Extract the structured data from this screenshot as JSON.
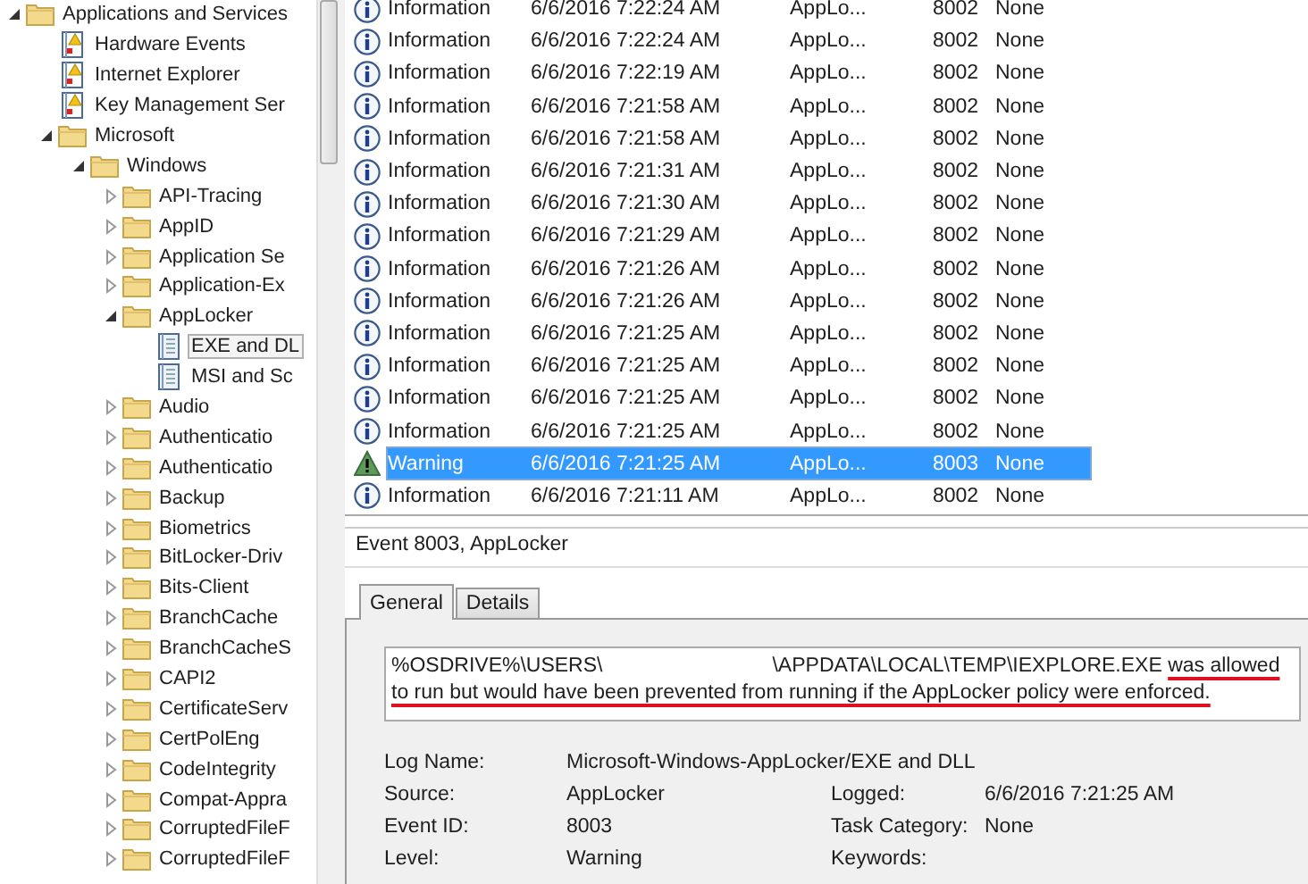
{
  "tree": [
    {
      "label": "Applications and Services",
      "kind": "folder",
      "expanded": true,
      "selected": false,
      "children": [
        {
          "label": "Hardware Events",
          "kind": "alert-log",
          "selected": false
        },
        {
          "label": "Internet Explorer",
          "kind": "alert-log",
          "selected": false
        },
        {
          "label": "Key Management Ser",
          "kind": "alert-log",
          "selected": false
        },
        {
          "label": "Microsoft",
          "kind": "folder",
          "expanded": true,
          "selected": false,
          "children": [
            {
              "label": "Windows",
              "kind": "folder",
              "expanded": true,
              "selected": false,
              "children": [
                {
                  "label": "API-Tracing",
                  "kind": "folder",
                  "expanded": false,
                  "selected": false
                },
                {
                  "label": "AppID",
                  "kind": "folder",
                  "expanded": false,
                  "selected": false
                },
                {
                  "label": "Application Se",
                  "kind": "folder",
                  "expanded": false,
                  "selected": false
                },
                {
                  "label": "Application-Ex",
                  "kind": "folder",
                  "expanded": false,
                  "selected": false
                },
                {
                  "label": "AppLocker",
                  "kind": "folder",
                  "expanded": true,
                  "selected": false,
                  "children": [
                    {
                      "label": "EXE and DL",
                      "kind": "log",
                      "selected": true
                    },
                    {
                      "label": "MSI and Sc",
                      "kind": "log",
                      "selected": false
                    }
                  ]
                },
                {
                  "label": "Audio",
                  "kind": "folder",
                  "expanded": false,
                  "selected": false
                },
                {
                  "label": "Authenticatio",
                  "kind": "folder",
                  "expanded": false,
                  "selected": false
                },
                {
                  "label": "Authenticatio",
                  "kind": "folder",
                  "expanded": false,
                  "selected": false
                },
                {
                  "label": "Backup",
                  "kind": "folder",
                  "expanded": false,
                  "selected": false
                },
                {
                  "label": "Biometrics",
                  "kind": "folder",
                  "expanded": false,
                  "selected": false
                },
                {
                  "label": "BitLocker-Driv",
                  "kind": "folder",
                  "expanded": false,
                  "selected": false
                },
                {
                  "label": "Bits-Client",
                  "kind": "folder",
                  "expanded": false,
                  "selected": false
                },
                {
                  "label": "BranchCache",
                  "kind": "folder",
                  "expanded": false,
                  "selected": false
                },
                {
                  "label": "BranchCacheS",
                  "kind": "folder",
                  "expanded": false,
                  "selected": false
                },
                {
                  "label": "CAPI2",
                  "kind": "folder",
                  "expanded": false,
                  "selected": false
                },
                {
                  "label": "CertificateServ",
                  "kind": "folder",
                  "expanded": false,
                  "selected": false
                },
                {
                  "label": "CertPolEng",
                  "kind": "folder",
                  "expanded": false,
                  "selected": false
                },
                {
                  "label": "CodeIntegrity",
                  "kind": "folder",
                  "expanded": false,
                  "selected": false
                },
                {
                  "label": "Compat-Appra",
                  "kind": "folder",
                  "expanded": false,
                  "selected": false
                },
                {
                  "label": "CorruptedFileF",
                  "kind": "folder",
                  "expanded": false,
                  "selected": false
                },
                {
                  "label": "CorruptedFileF",
                  "kind": "folder",
                  "expanded": false,
                  "selected": false
                }
              ]
            }
          ]
        }
      ]
    }
  ],
  "events": [
    {
      "kind": "information",
      "label": "Information",
      "date": "6/6/2016 7:22:24 AM",
      "source": "AppLo...",
      "event_id": "8002",
      "task": "None",
      "selected": false
    },
    {
      "kind": "information",
      "label": "Information",
      "date": "6/6/2016 7:22:24 AM",
      "source": "AppLo...",
      "event_id": "8002",
      "task": "None",
      "selected": false
    },
    {
      "kind": "information",
      "label": "Information",
      "date": "6/6/2016 7:22:19 AM",
      "source": "AppLo...",
      "event_id": "8002",
      "task": "None",
      "selected": false
    },
    {
      "kind": "information",
      "label": "Information",
      "date": "6/6/2016 7:21:58 AM",
      "source": "AppLo...",
      "event_id": "8002",
      "task": "None",
      "selected": false
    },
    {
      "kind": "information",
      "label": "Information",
      "date": "6/6/2016 7:21:58 AM",
      "source": "AppLo...",
      "event_id": "8002",
      "task": "None",
      "selected": false
    },
    {
      "kind": "information",
      "label": "Information",
      "date": "6/6/2016 7:21:31 AM",
      "source": "AppLo...",
      "event_id": "8002",
      "task": "None",
      "selected": false
    },
    {
      "kind": "information",
      "label": "Information",
      "date": "6/6/2016 7:21:30 AM",
      "source": "AppLo...",
      "event_id": "8002",
      "task": "None",
      "selected": false
    },
    {
      "kind": "information",
      "label": "Information",
      "date": "6/6/2016 7:21:29 AM",
      "source": "AppLo...",
      "event_id": "8002",
      "task": "None",
      "selected": false
    },
    {
      "kind": "information",
      "label": "Information",
      "date": "6/6/2016 7:21:26 AM",
      "source": "AppLo...",
      "event_id": "8002",
      "task": "None",
      "selected": false
    },
    {
      "kind": "information",
      "label": "Information",
      "date": "6/6/2016 7:21:26 AM",
      "source": "AppLo...",
      "event_id": "8002",
      "task": "None",
      "selected": false
    },
    {
      "kind": "information",
      "label": "Information",
      "date": "6/6/2016 7:21:25 AM",
      "source": "AppLo...",
      "event_id": "8002",
      "task": "None",
      "selected": false
    },
    {
      "kind": "information",
      "label": "Information",
      "date": "6/6/2016 7:21:25 AM",
      "source": "AppLo...",
      "event_id": "8002",
      "task": "None",
      "selected": false
    },
    {
      "kind": "information",
      "label": "Information",
      "date": "6/6/2016 7:21:25 AM",
      "source": "AppLo...",
      "event_id": "8002",
      "task": "None",
      "selected": false
    },
    {
      "kind": "information",
      "label": "Information",
      "date": "6/6/2016 7:21:25 AM",
      "source": "AppLo...",
      "event_id": "8002",
      "task": "None",
      "selected": false
    },
    {
      "kind": "warning",
      "label": "Warning",
      "date": "6/6/2016 7:21:25 AM",
      "source": "AppLo...",
      "event_id": "8003",
      "task": "None",
      "selected": true
    },
    {
      "kind": "information",
      "label": "Information",
      "date": "6/6/2016 7:21:11 AM",
      "source": "AppLo...",
      "event_id": "8002",
      "task": "None",
      "selected": false
    }
  ],
  "detail": {
    "title": "Event 8003, AppLocker",
    "tabs": [
      {
        "label": "General",
        "selected": true
      },
      {
        "label": "Details",
        "selected": false
      }
    ],
    "message": {
      "path_start": "%OSDRIVE%\\USERS\\",
      "path_end": "\\APPDATA\\LOCAL\\TEMP\\IEXPLORE.EXE",
      "sentence": "was allowed to run but would have been prevented from running if the AppLocker policy were enforced."
    },
    "fields": [
      [
        {
          "label": "Log Name:",
          "value": "Microsoft-Windows-AppLocker/EXE and DLL"
        }
      ],
      [
        {
          "label": "Source:",
          "value": "AppLocker"
        },
        {
          "label": "Logged:",
          "value": "6/6/2016 7:21:25 AM"
        }
      ],
      [
        {
          "label": "Event ID:",
          "value": "8003"
        },
        {
          "label": "Task Category:",
          "value": "None"
        }
      ],
      [
        {
          "label": "Level:",
          "value": "Warning"
        },
        {
          "label": "Keywords:"
        }
      ]
    ]
  }
}
